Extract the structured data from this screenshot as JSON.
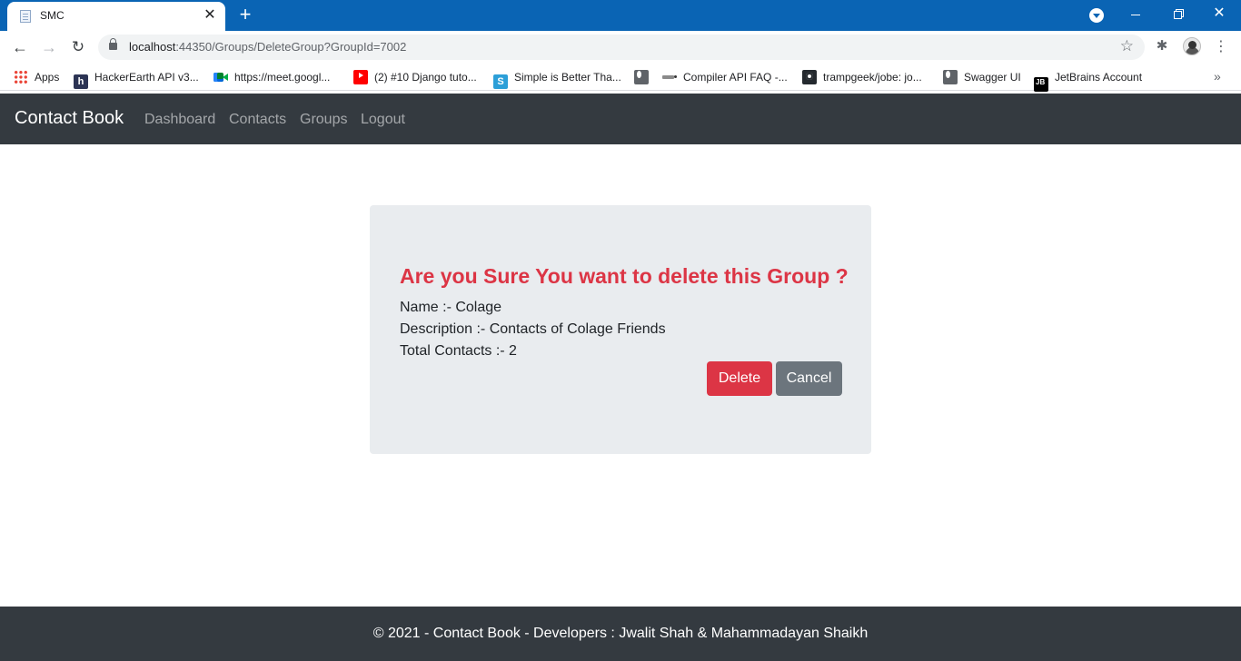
{
  "browser": {
    "tab_title": "SMC",
    "tab_close": "✕",
    "new_tab": "+",
    "url_host": "localhost",
    "url_rest": ":44350/Groups/DeleteGroup?GroupId=7002",
    "accent_color": "#0a64b4"
  },
  "bookmarks": [
    {
      "label": "Apps",
      "icon": "apps-grid-icon"
    },
    {
      "label": "HackerEarth API v3...",
      "icon": "hackerearth-icon",
      "glyph": "h"
    },
    {
      "label": "https://meet.googl...",
      "icon": "google-meet-icon"
    },
    {
      "label": "(2) #10 Django tuto...",
      "icon": "youtube-icon"
    },
    {
      "label": "Simple is Better Tha...",
      "icon": "simple-is-better-icon",
      "glyph": "S"
    },
    {
      "label": "",
      "icon": "globe-icon"
    },
    {
      "label": "Compiler API FAQ -...",
      "icon": "compiler-icon"
    },
    {
      "label": "trampgeek/jobe: jo...",
      "icon": "github-icon"
    },
    {
      "label": "Swagger UI",
      "icon": "globe-icon"
    },
    {
      "label": "JetBrains Account",
      "icon": "jetbrains-icon",
      "glyph": "JB"
    }
  ],
  "navbar": {
    "brand": "Contact Book",
    "links": [
      "Dashboard",
      "Contacts",
      "Groups",
      "Logout"
    ]
  },
  "dialog": {
    "title": "Are you Sure You want to delete this Group ?",
    "name_line": "Name :- Colage",
    "description_line": "Description :- Contacts of Colage Friends",
    "total_line": "Total Contacts :- 2",
    "delete_label": "Delete",
    "cancel_label": "Cancel",
    "danger_color": "#dc3545",
    "secondary_color": "#6c757d"
  },
  "footer": {
    "text": "© 2021 - Contact Book - Developers : Jwalit Shah & Mahammadayan Shaikh"
  }
}
